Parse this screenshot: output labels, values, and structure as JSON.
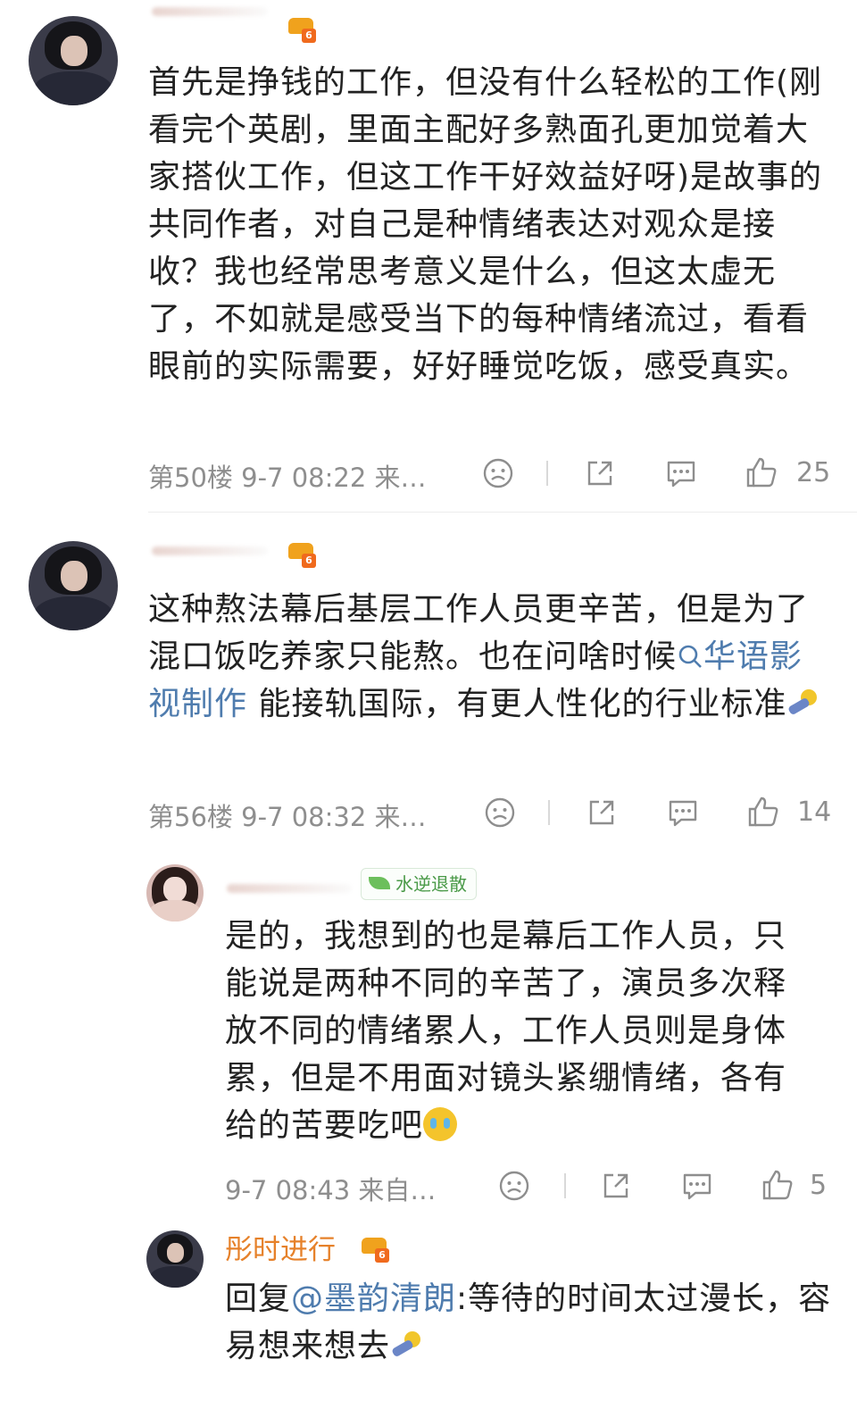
{
  "comments": [
    {
      "text": "首先是挣钱的工作，但没有什么轻松的工作(刚看完个英剧，里面主配好多熟面孔更加觉着大家搭伙工作，但这工作干好效益好呀)是故事的共同作者，对自己是种情绪表达对观众是接收？我也经常思考意义是什么，但这太虚无了，不如就是感受当下的每种情绪流过，看看眼前的实际需要，好好睡觉吃饭，感受真实。",
      "meta": "第50楼  9-7 08:22  来…",
      "likes": "25",
      "badge_level": "6"
    },
    {
      "text_before": "这种熬法幕后基层工作人员更辛苦，但是为了混口饭吃养家只能熬。也在问啥时候",
      "topic": "华语影视制作",
      "text_after": " 能接轨国际，有更人性化的行业标准",
      "meta": "第56楼  9-7 08:32  来…",
      "likes": "14",
      "badge_level": "6"
    }
  ],
  "reply1": {
    "tag": "水逆退散",
    "text": "是的，我想到的也是幕后工作人员，只能说是两种不同的辛苦了，演员多次释放不同的情绪累人，工作人员则是身体累，但是不用面对镜头紧绷情绪，各有给的苦要吃吧",
    "meta": "9-7 08:43  来自…",
    "likes": "5"
  },
  "reply2": {
    "username": "彤时进行",
    "badge_level": "6",
    "prefix": "回复",
    "mention": "@墨韵清朗",
    "text": ":等待的时间太过漫长，容易想来想去"
  },
  "icons": {
    "dislike": "sad-face-icon",
    "share": "share-icon",
    "comment": "comment-icon",
    "like": "thumbs-up-icon",
    "emoji_hand": "sleepy-hand-emoji",
    "emoji_cry": "crying-face-emoji"
  },
  "colors": {
    "username": "#e6812a",
    "link": "#4f7cae",
    "meta": "#8e8e8e"
  }
}
